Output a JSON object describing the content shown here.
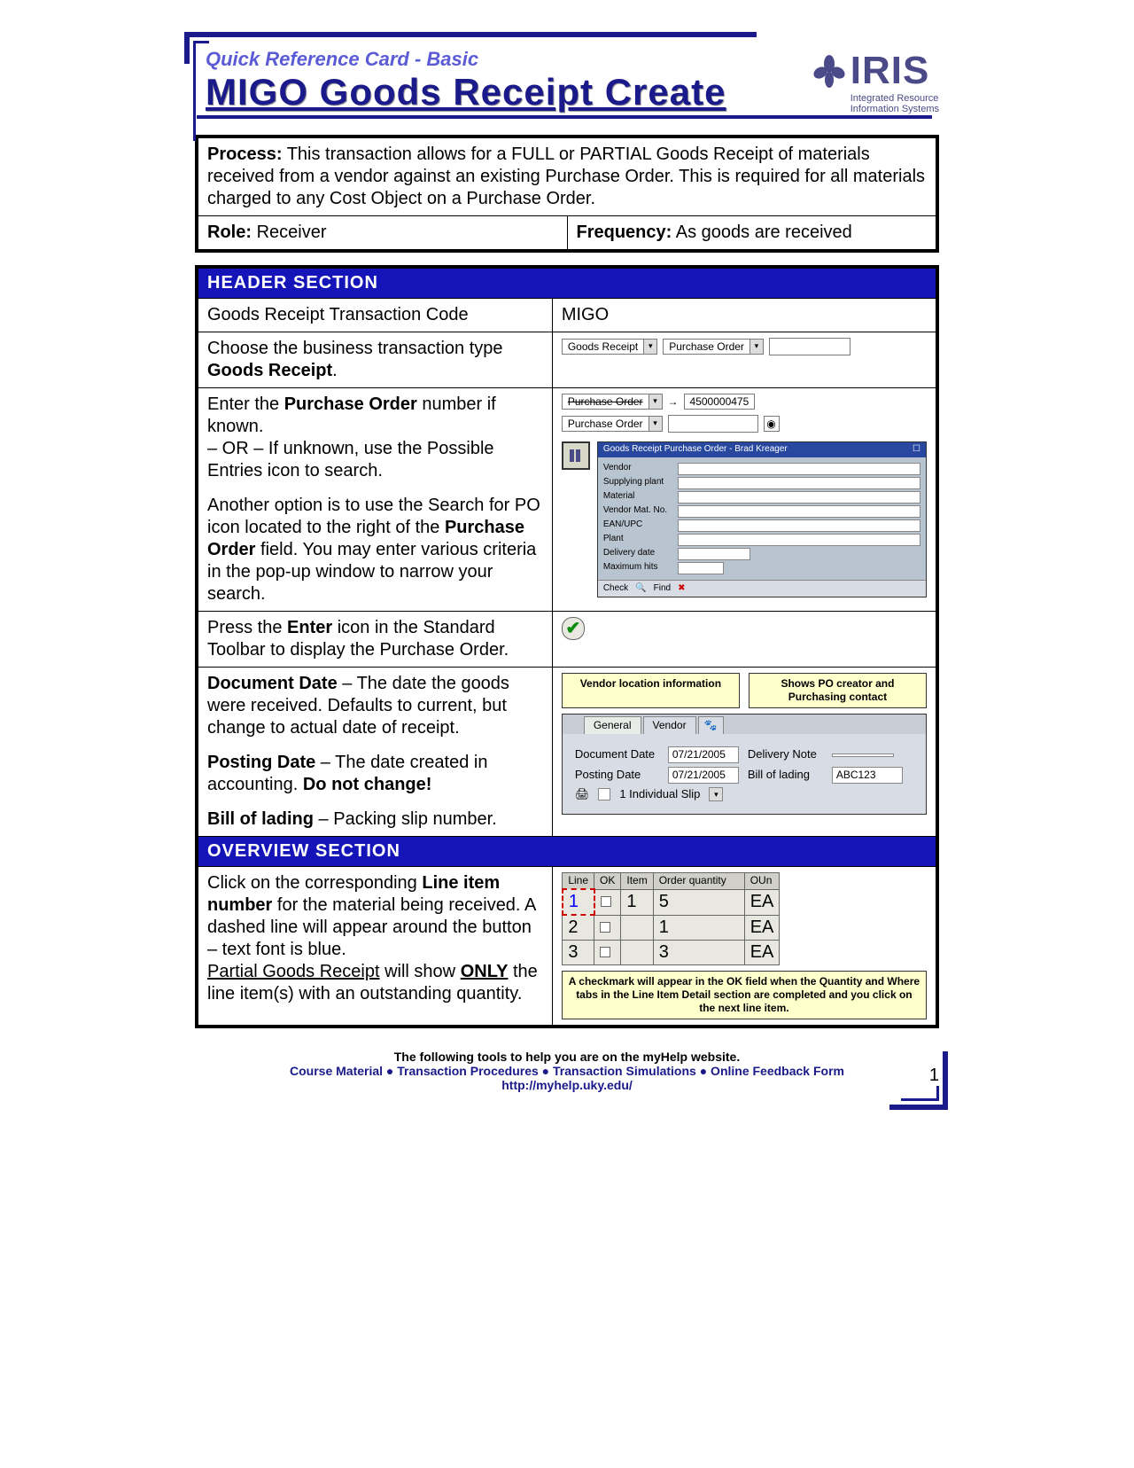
{
  "header": {
    "subtitle": "Quick Reference Card - Basic",
    "title": "MIGO Goods Receipt Create",
    "logo_text": "IRIS",
    "logo_sub1": "Integrated Resource",
    "logo_sub2": "Information Systems"
  },
  "process": {
    "label": "Process:",
    "text": "This transaction allows for a FULL or PARTIAL Goods Receipt of materials received from a vendor against an existing Purchase Order.  This is required for all materials charged to any Cost Object on a Purchase Order."
  },
  "role": {
    "label": "Role:",
    "value": "Receiver"
  },
  "frequency": {
    "label": "Frequency:",
    "value": "As goods are received"
  },
  "sections": {
    "header_section": "HEADER SECTION",
    "overview_section": "OVERVIEW SECTION"
  },
  "rows": {
    "r1_left": "Goods Receipt Transaction Code",
    "r1_right": "MIGO",
    "r2_left_a": "Choose the business transaction type ",
    "r2_left_b": "Goods Receipt",
    "r2_left_c": ".",
    "r2_dd1": "Goods Receipt",
    "r2_dd2": "Purchase Order",
    "r3_a": "Enter the ",
    "r3_b": "Purchase Order",
    "r3_c": " number if known.",
    "r3_or": "– OR – If unknown, use the Possible Entries icon to search.",
    "r3_po_label": "Purchase Order",
    "r3_po_value": "4500000475",
    "r3_p2a": "Another option is to use the Search for PO icon located to the right of the ",
    "r3_p2b": "Purchase Order",
    "r3_p2c": " field.  You may enter various criteria in the pop-up window to narrow your search.",
    "r4_a": "Press the ",
    "r4_b": "Enter",
    "r4_c": " icon in the Standard Toolbar to display the Purchase Order.",
    "r5_doc_a": "Document Date",
    "r5_doc_b": " – The date the goods were received.  Defaults to current, but change to actual date of receipt.",
    "r5_post_a": "Posting Date",
    "r5_post_b": " – The date created in accounting.  ",
    "r5_post_c": "Do not change!",
    "r5_bill_a": "Bill of lading",
    "r5_bill_b": " – Packing slip number.",
    "ov_a": "Click on the corresponding ",
    "ov_b": "Line item number",
    "ov_c": " for the material being received.  A dashed line will appear around the button – text font is blue.",
    "ov_p2a": "Partial Goods Receipt",
    "ov_p2b": " will show ",
    "ov_p2c": "ONLY",
    "ov_p2d": " the line item(s) with an outstanding quantity."
  },
  "callouts": {
    "vendor": "Vendor location information",
    "creator": "Shows PO creator and Purchasing contact",
    "checkmark": "A checkmark will appear in the OK field when the Quantity and Where tabs in the Line Item Detail section are completed and you click on the next line item."
  },
  "sap": {
    "tab_general": "General",
    "tab_vendor": "Vendor",
    "f_docdate_lbl": "Document Date",
    "f_docdate_val": "07/21/2005",
    "f_postdate_lbl": "Posting Date",
    "f_postdate_val": "07/21/2005",
    "f_delnote_lbl": "Delivery Note",
    "f_bill_lbl": "Bill of lading",
    "f_bill_val": "ABC123",
    "f_slip": "1 Individual Slip",
    "search_title": "Goods Receipt Purchase Order - Brad Kreager",
    "search_fields": [
      "Vendor",
      "Supplying plant",
      "Material",
      "Vendor Mat. No.",
      "EAN/UPC",
      "Plant",
      "Delivery date",
      "Maximum hits"
    ],
    "search_check": "Check",
    "search_find": "Find"
  },
  "grid": {
    "h_line": "Line",
    "h_ok": "OK",
    "h_item": "Item",
    "h_qty": "Order quantity",
    "h_oun": "OUn",
    "rows": [
      {
        "line": "1",
        "item": "1",
        "qty": "5",
        "oun": "EA"
      },
      {
        "line": "2",
        "item": "",
        "qty": "1",
        "oun": "EA"
      },
      {
        "line": "3",
        "item": "",
        "qty": "3",
        "oun": "EA"
      }
    ]
  },
  "footer": {
    "line1": "The following tools to help you are on the myHelp website.",
    "links": "Course Material ● Transaction Procedures ● Transaction Simulations ● Online Feedback Form",
    "url": "http://myhelp.uky.edu/",
    "page": "1"
  }
}
